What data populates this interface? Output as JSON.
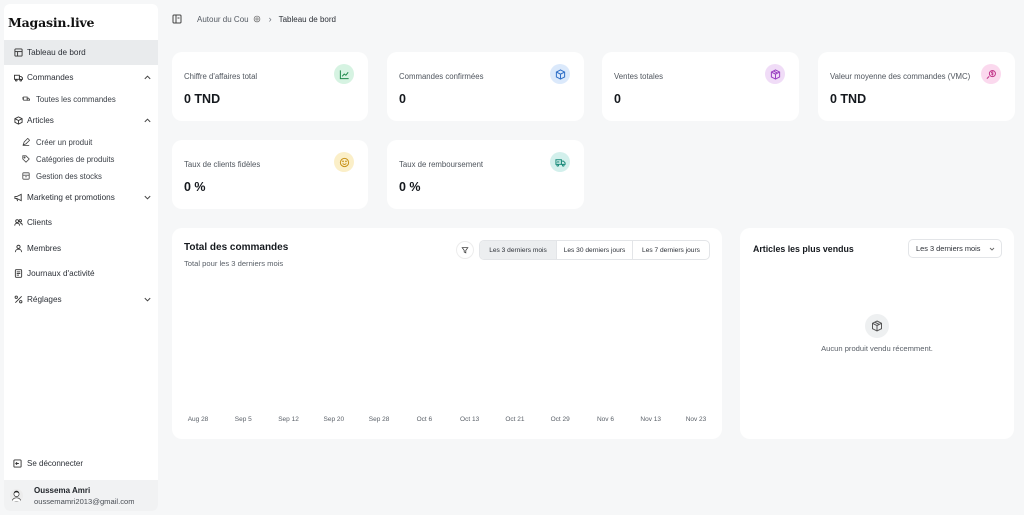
{
  "app": {
    "logo": "Magasin.live"
  },
  "sidebar": {
    "dashboard": "Tableau de bord",
    "orders": "Commandes",
    "all_orders": "Toutes les commandes",
    "articles": "Articles",
    "create_product": "Créer un produit",
    "categories": "Catégories de produits",
    "stock": "Gestion des stocks",
    "marketing": "Marketing et promotions",
    "clients": "Clients",
    "members": "Membres",
    "activity": "Journaux d'activité",
    "settings": "Réglages",
    "logout": "Se déconnecter"
  },
  "user": {
    "name": "Oussema Amri",
    "email": "oussemamri2013@gmail.com"
  },
  "breadcrumb": {
    "store": "Autour du Cou",
    "current": "Tableau de bord"
  },
  "kpis": [
    {
      "label": "Chiffre d'affaires total",
      "value": "0 TND",
      "icon": "chart-up-icon",
      "color": "#d6f3e2"
    },
    {
      "label": "Commandes confirmées",
      "value": "0",
      "icon": "box-icon",
      "color": "#dbe9fb"
    },
    {
      "label": "Ventes totales",
      "value": "0",
      "icon": "package-icon",
      "color": "#f0dcf7"
    },
    {
      "label": "Valeur moyenne des commandes (VMC)",
      "value": "0 TND",
      "icon": "dollar-icon",
      "color": "#fbd9ee"
    },
    {
      "label": "Taux de clients fidèles",
      "value": "0 %",
      "icon": "smile-icon",
      "color": "#fbefc8"
    },
    {
      "label": "Taux de remboursement",
      "value": "0 %",
      "icon": "refund-truck-icon",
      "color": "#d3f0ec"
    }
  ],
  "orders_chart": {
    "title": "Total des commandes",
    "subtitle": "Total pour les 3 derniers mois",
    "ranges": [
      "Les 3 derniers mois",
      "Les 30 derniers jours",
      "Les 7 derniers jours"
    ],
    "active_range": "Les 3 derniers mois"
  },
  "chart_data": {
    "type": "line",
    "x": [
      "Aug 28",
      "Sep 5",
      "Sep 12",
      "Sep 20",
      "Sep 28",
      "Oct 6",
      "Oct 13",
      "Oct 21",
      "Oct 29",
      "Nov 6",
      "Nov 13",
      "Nov 23"
    ],
    "series": [],
    "title": "Total des commandes",
    "subtitle": "Total pour les 3 derniers mois",
    "xlabel": "",
    "ylabel": "",
    "grid": false
  },
  "best_sellers": {
    "title": "Articles les plus vendus",
    "range": "Les 3 derniers mois",
    "empty": "Aucun produit vendu récemment."
  }
}
